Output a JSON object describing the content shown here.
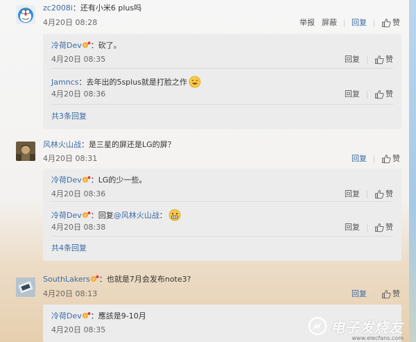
{
  "actions": {
    "report": "举报",
    "block": "屏蔽",
    "reply": "回复",
    "like": "赞"
  },
  "comments": [
    {
      "user": "zc2008i",
      "text": "：还有小米6 plus吗",
      "time": "4月20日 08:28",
      "replies": [
        {
          "user": "冷荷Dev",
          "text": "：砍了。",
          "time": "4月20日 08:35"
        },
        {
          "user": "Jamncs",
          "text": "：去年出的5splus就是打脸之作",
          "time": "4月20日 08:36"
        }
      ],
      "more": "共3条回复"
    },
    {
      "user": "风林火山战",
      "text": "：是三星的屏还是LG的屏？",
      "time": "4月20日 08:31",
      "replies": [
        {
          "user": "冷荷Dev",
          "text": "：LG的少一些。",
          "time": "4月20日 08:36"
        },
        {
          "user": "冷荷Dev",
          "text": "：回复",
          "mention": "@风林火山战",
          "after": "：",
          "time": "4月20日 08:38"
        }
      ],
      "more": "共4条回复"
    },
    {
      "user": "SouthLakers",
      "text": "：也就是7月会发布note3?",
      "time": "4月20日 08:13",
      "replies": [
        {
          "user": "冷荷Dev",
          "text": "：應該是9-10月",
          "time": "4月20日 08:35"
        }
      ]
    }
  ],
  "watermark": {
    "text": "电子发烧友",
    "url": "www.elecfans.com"
  },
  "colors": {
    "link": "#3b6aa3",
    "reply_bg": "#ececec",
    "text": "#333333"
  }
}
